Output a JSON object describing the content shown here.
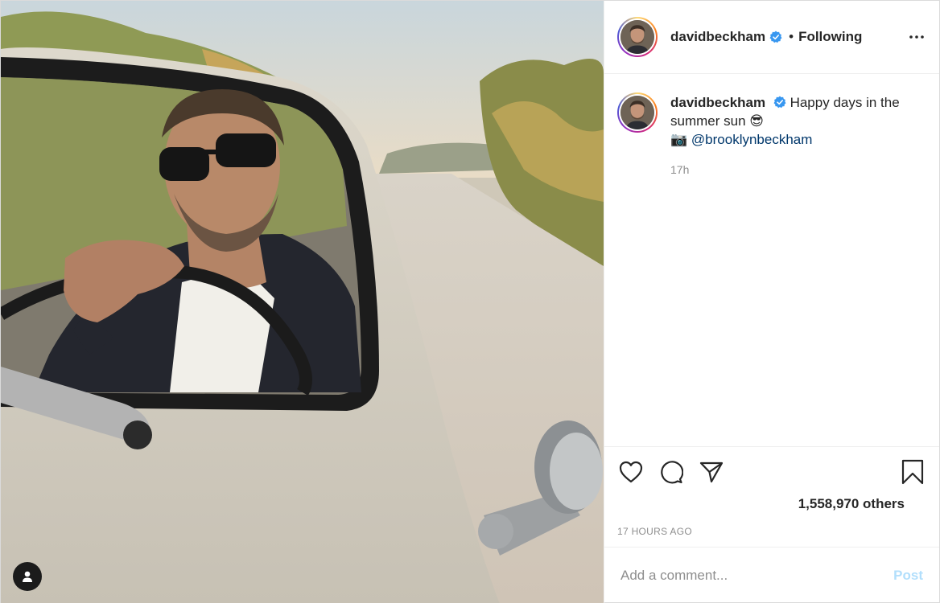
{
  "post": {
    "username": "davidbeckham",
    "dot": "•",
    "follow_status": "Following",
    "more_icon": "more-horizontal-icon"
  },
  "caption": {
    "username": "davidbeckham",
    "text": "Happy days in the summer sun 😎",
    "camera_emoji": "📷",
    "mention": "@brooklynbeckham",
    "time_ago": "17h"
  },
  "actions": {
    "like_icon": "heart-icon",
    "comment_icon": "comment-icon",
    "share_icon": "paper-plane-icon",
    "save_icon": "bookmark-icon"
  },
  "likes_text": "1,558,970 others",
  "timestamp": "17 HOURS AGO",
  "comment": {
    "placeholder": "Add a comment...",
    "post_label": "Post"
  },
  "media": {
    "description": "user-tag-icon"
  },
  "colors": {
    "verified": "#3897f0",
    "post_button_disabled": "#b2dffc",
    "mention": "#00376b",
    "secondary_text": "#8e8e8e"
  }
}
